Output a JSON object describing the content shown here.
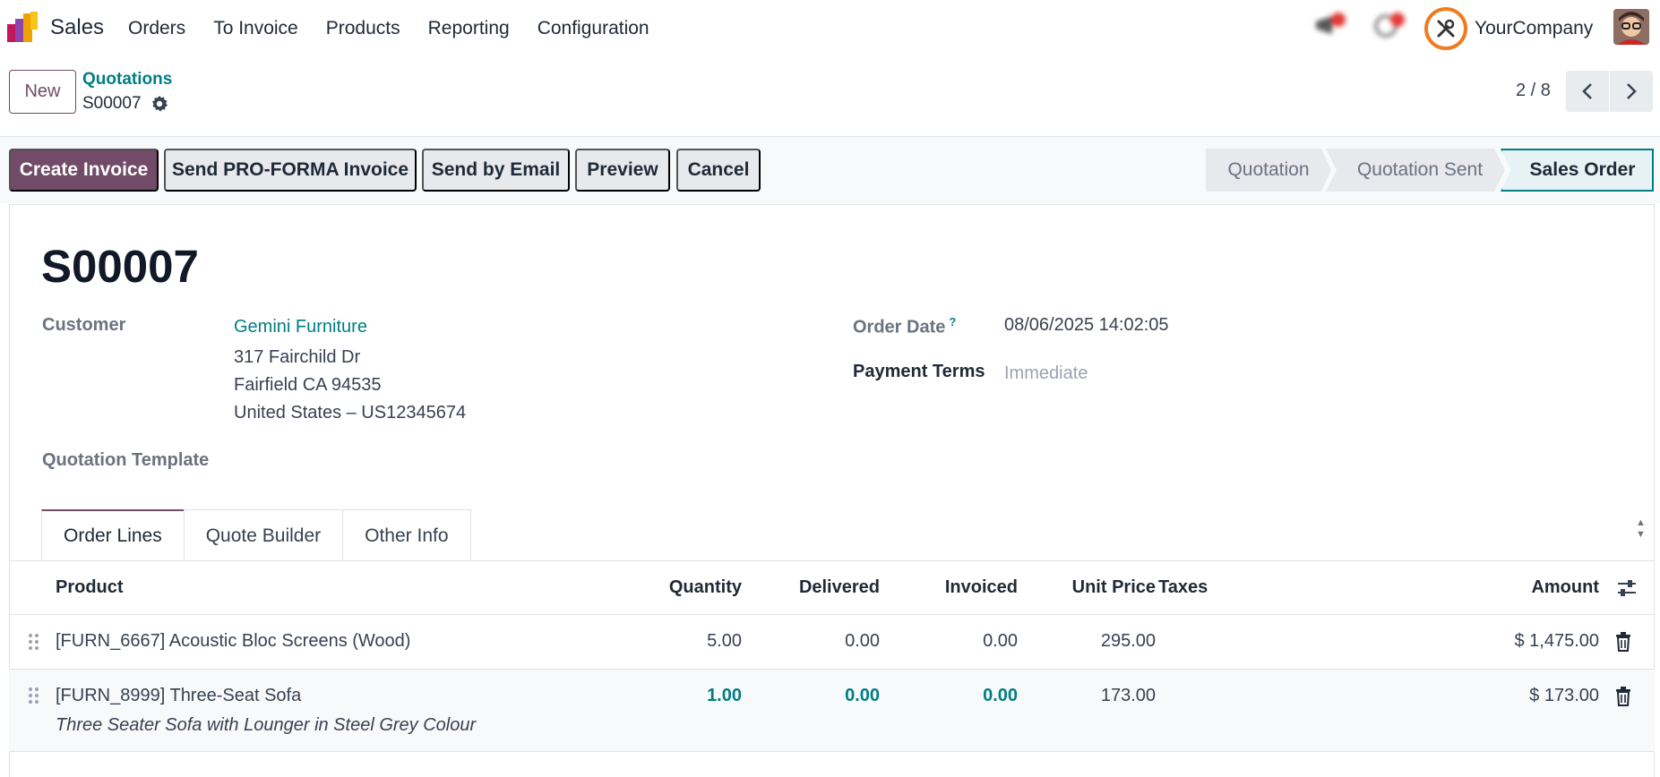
{
  "navbar": {
    "app_name": "Sales",
    "menu": [
      "Orders",
      "To Invoice",
      "Products",
      "Reporting",
      "Configuration"
    ],
    "company": "YourCompany"
  },
  "control_panel": {
    "new_label": "New",
    "breadcrumb": "Quotations",
    "record": "S00007",
    "pager": "2 / 8"
  },
  "actions": {
    "create_invoice": "Create Invoice",
    "send_proforma": "Send PRO-FORMA Invoice",
    "send_email": "Send by Email",
    "preview": "Preview",
    "cancel": "Cancel"
  },
  "statusbar": {
    "stages": [
      "Quotation",
      "Quotation Sent",
      "Sales Order"
    ],
    "current": "Sales Order"
  },
  "form": {
    "title": "S00007",
    "customer_label": "Customer",
    "customer_name": "Gemini Furniture",
    "address_line1": "317 Fairchild Dr",
    "address_line2": "Fairfield CA 94535",
    "address_line3": "United States – US12345674",
    "template_label": "Quotation Template",
    "order_date_label": "Order Date",
    "order_date_help": "?",
    "order_date": "08/06/2025 14:02:05",
    "payment_terms_label": "Payment Terms",
    "payment_terms": "Immediate"
  },
  "tabs": [
    "Order Lines",
    "Quote Builder",
    "Other Info"
  ],
  "table": {
    "headers": {
      "product": "Product",
      "quantity": "Quantity",
      "delivered": "Delivered",
      "invoiced": "Invoiced",
      "unit_price": "Unit Price",
      "taxes": "Taxes",
      "amount": "Amount"
    },
    "rows": [
      {
        "product": "[FURN_6667] Acoustic Bloc Screens (Wood)",
        "quantity": "5.00",
        "delivered": "0.00",
        "invoiced": "0.00",
        "unit_price": "295.00",
        "amount": "$ 1,475.00"
      },
      {
        "product": "[FURN_8999] Three-Seat Sofa",
        "description": "Three Seater Sofa with Lounger in Steel Grey Colour",
        "quantity": "1.00",
        "delivered": "0.00",
        "invoiced": "0.00",
        "unit_price": "173.00",
        "amount": "$ 173.00"
      }
    ]
  },
  "colors": {
    "brand": "#714b67",
    "link": "#017e84",
    "debug_ring": "#f07c1f"
  }
}
